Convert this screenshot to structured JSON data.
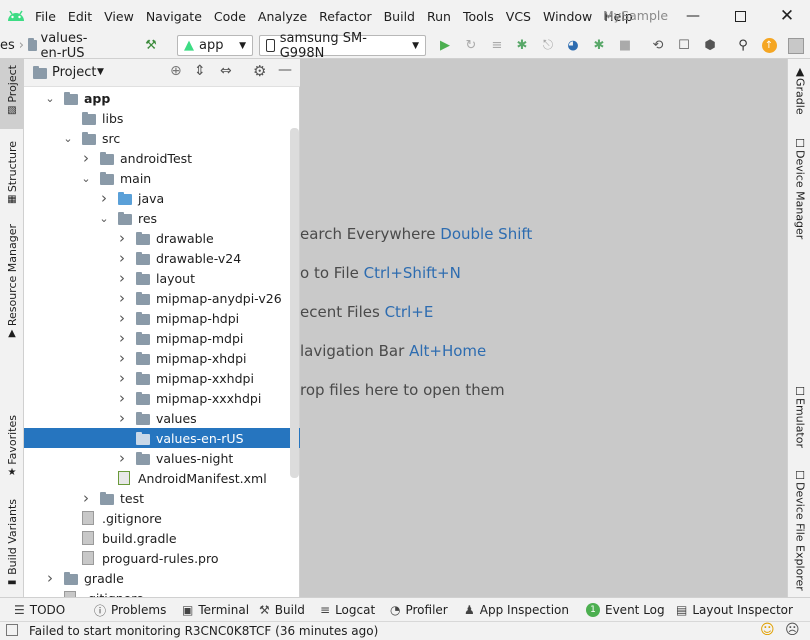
{
  "menu": [
    "File",
    "Edit",
    "View",
    "Navigate",
    "Code",
    "Analyze",
    "Refactor",
    "Build",
    "Run",
    "Tools",
    "VCS",
    "Window",
    "Help"
  ],
  "app_name": "MySample",
  "toolbar": {
    "breadcrumb_prefix": "es",
    "breadcrumb_folder": "values-en-rUS",
    "run_config": "app",
    "device": "samsung SM-G998N"
  },
  "left_tabs": [
    "Project",
    "Structure",
    "Resource Manager",
    "Favorites",
    "Build Variants"
  ],
  "right_tabs": [
    "Gradle",
    "Device Manager",
    "Emulator",
    "Device File Explorer"
  ],
  "project_panel": {
    "title": "Project"
  },
  "tree": [
    {
      "label": "app",
      "depth": 0,
      "expanded": true,
      "icon": "module",
      "bold": true
    },
    {
      "label": "libs",
      "depth": 1,
      "expanded": null,
      "icon": "folder"
    },
    {
      "label": "src",
      "depth": 1,
      "expanded": true,
      "icon": "folder"
    },
    {
      "label": "androidTest",
      "depth": 2,
      "expanded": false,
      "icon": "folder"
    },
    {
      "label": "main",
      "depth": 2,
      "expanded": true,
      "icon": "folder"
    },
    {
      "label": "java",
      "depth": 3,
      "expanded": false,
      "icon": "folder-blue"
    },
    {
      "label": "res",
      "depth": 3,
      "expanded": true,
      "icon": "folder-res"
    },
    {
      "label": "drawable",
      "depth": 4,
      "expanded": false,
      "icon": "folder"
    },
    {
      "label": "drawable-v24",
      "depth": 4,
      "expanded": false,
      "icon": "folder"
    },
    {
      "label": "layout",
      "depth": 4,
      "expanded": false,
      "icon": "folder"
    },
    {
      "label": "mipmap-anydpi-v26",
      "depth": 4,
      "expanded": false,
      "icon": "folder"
    },
    {
      "label": "mipmap-hdpi",
      "depth": 4,
      "expanded": false,
      "icon": "folder"
    },
    {
      "label": "mipmap-mdpi",
      "depth": 4,
      "expanded": false,
      "icon": "folder"
    },
    {
      "label": "mipmap-xhdpi",
      "depth": 4,
      "expanded": false,
      "icon": "folder"
    },
    {
      "label": "mipmap-xxhdpi",
      "depth": 4,
      "expanded": false,
      "icon": "folder"
    },
    {
      "label": "mipmap-xxxhdpi",
      "depth": 4,
      "expanded": false,
      "icon": "folder"
    },
    {
      "label": "values",
      "depth": 4,
      "expanded": false,
      "icon": "folder"
    },
    {
      "label": "values-en-rUS",
      "depth": 4,
      "expanded": null,
      "icon": "folder",
      "selected": true
    },
    {
      "label": "values-night",
      "depth": 4,
      "expanded": false,
      "icon": "folder"
    },
    {
      "label": "AndroidManifest.xml",
      "depth": 3,
      "expanded": null,
      "icon": "manifest"
    },
    {
      "label": "test",
      "depth": 2,
      "expanded": false,
      "icon": "folder"
    },
    {
      "label": ".gitignore",
      "depth": 1,
      "expanded": null,
      "icon": "file"
    },
    {
      "label": "build.gradle",
      "depth": 1,
      "expanded": null,
      "icon": "gradle"
    },
    {
      "label": "proguard-rules.pro",
      "depth": 1,
      "expanded": null,
      "icon": "file"
    },
    {
      "label": "gradle",
      "depth": 0,
      "expanded": false,
      "icon": "folder"
    },
    {
      "label": ".gitignore",
      "depth": 0,
      "expanded": null,
      "icon": "file"
    }
  ],
  "editor_hints": [
    {
      "text": "earch Everywhere",
      "key": "Double Shift"
    },
    {
      "text": "o to File",
      "key": "Ctrl+Shift+N"
    },
    {
      "text": "ecent Files",
      "key": "Ctrl+E"
    },
    {
      "text": "lavigation Bar",
      "key": "Alt+Home"
    },
    {
      "text": "rop files here to open them",
      "key": ""
    }
  ],
  "bottom_tabs": [
    {
      "label": "TODO",
      "icon": "list-icon"
    },
    {
      "label": "Problems",
      "icon": "problems-icon"
    },
    {
      "label": "Terminal",
      "icon": "terminal-icon"
    },
    {
      "label": "Build",
      "icon": "hammer-icon"
    },
    {
      "label": "Logcat",
      "icon": "logcat-icon"
    },
    {
      "label": "Profiler",
      "icon": "gauge-icon"
    },
    {
      "label": "App Inspection",
      "icon": "inspection-icon"
    },
    {
      "label": "Event Log",
      "icon": "event-log-icon",
      "badge": "1"
    },
    {
      "label": "Layout Inspector",
      "icon": "layout-inspector-icon"
    }
  ],
  "status": {
    "message": "Failed to start monitoring R3CNC0K8TCF (36 minutes ago)"
  },
  "colors": {
    "accent": "#2675bf",
    "android": "#3ddc84",
    "run": "#4caf50",
    "debug": "#59a869"
  }
}
